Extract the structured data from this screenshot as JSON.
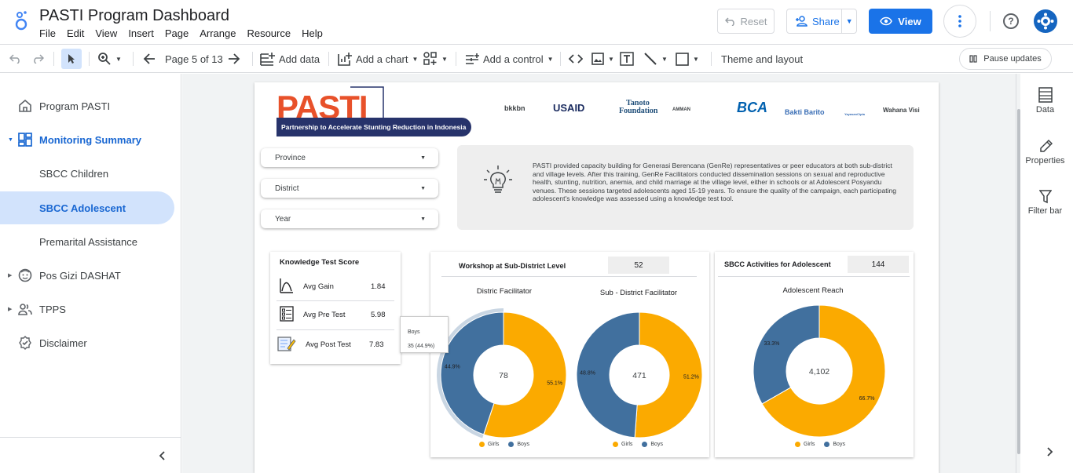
{
  "app": {
    "title": "PASTI Program Dashboard",
    "menu": [
      "File",
      "Edit",
      "View",
      "Insert",
      "Page",
      "Arrange",
      "Resource",
      "Help"
    ],
    "reset_label": "Reset",
    "share_label": "Share",
    "view_label": "View"
  },
  "toolbar": {
    "page_label": "Page 5 of 13",
    "add_data": "Add data",
    "add_chart": "Add a chart",
    "add_control": "Add a control",
    "theme": "Theme and layout",
    "pause": "Pause updates"
  },
  "sidebar": {
    "items": [
      {
        "label": "Program PASTI"
      },
      {
        "label": "Monitoring Summary"
      },
      {
        "label": "SBCC Children"
      },
      {
        "label": "SBCC Adolescent"
      },
      {
        "label": "Premarital Assistance"
      },
      {
        "label": "Pos Gizi DASHAT"
      },
      {
        "label": "TPPS"
      },
      {
        "label": "Disclaimer"
      }
    ]
  },
  "right_panel": {
    "data": "Data",
    "properties": "Properties",
    "filter_bar": "Filter bar"
  },
  "report": {
    "logo_text": "PASTI",
    "logo_subtitle": "Partnership to Accelerate Stunting Reduction in Indonesia",
    "partners": [
      "bkkbn",
      "USAID",
      "Tanoto Foundation",
      "AMMAN",
      "BCA",
      "Bakti Barito",
      "YayasanCipta",
      "Wahana Visi"
    ],
    "filters": {
      "province": "Province",
      "district": "District",
      "year": "Year"
    },
    "info_text": "PASTI provided capacity building for Generasi Berencana (GenRe) representatives or peer educators at both sub-district and village levels. After this training, GenRe Facilitators conducted dissemination sessions on sexual and reproductive health, stunting, nutrition, anemia, and child marriage at the village level, either in schools or at Adolescent Posyandu venues. These sessions targeted adolescents aged 15-19 years. To ensure the quality of the campaign, each participating adolescent's knowledge was assessed using a knowledge test tool.",
    "knowledge": {
      "title": "Knowledge Test Score",
      "rows": [
        {
          "label": "Avg Gain",
          "value": "1.84"
        },
        {
          "label": "Avg Pre Test",
          "value": "5.98"
        },
        {
          "label": "Avg Post Test",
          "value": "7.83"
        }
      ]
    },
    "tooltip": {
      "series": "Boys",
      "value": "35 (44.9%)"
    },
    "workshop": {
      "title": "Workshop at Sub-District Level",
      "total": "52",
      "chart1_label": "Distric Facilitator",
      "chart2_label": "Sub - District Facilitator"
    },
    "sbcc": {
      "title": "SBCC Activities for Adolescent",
      "total": "144",
      "chart_label": "Adolescent Reach"
    },
    "legend": {
      "girls": "Girls",
      "boys": "Boys"
    },
    "colors": {
      "girls": "#fbaa00",
      "boys": "#41709e",
      "accent": "#e8512a",
      "navy": "#27336b"
    }
  },
  "chart_data": [
    {
      "type": "pie",
      "title": "Distric Facilitator",
      "categories": [
        "Girls",
        "Boys"
      ],
      "values": [
        43,
        35
      ],
      "percent_labels": [
        "55.1%",
        "44.9%"
      ],
      "total_label": "78"
    },
    {
      "type": "pie",
      "title": "Sub - District Facilitator",
      "categories": [
        "Girls",
        "Boys"
      ],
      "values": [
        241,
        230
      ],
      "percent_labels": [
        "51.2%",
        "48.8%"
      ],
      "total_label": "471"
    },
    {
      "type": "pie",
      "title": "Adolescent Reach",
      "categories": [
        "Girls",
        "Boys"
      ],
      "values": [
        2736,
        1366
      ],
      "percent_labels": [
        "66.7%",
        "33.3%"
      ],
      "total_label": "4,102"
    }
  ]
}
